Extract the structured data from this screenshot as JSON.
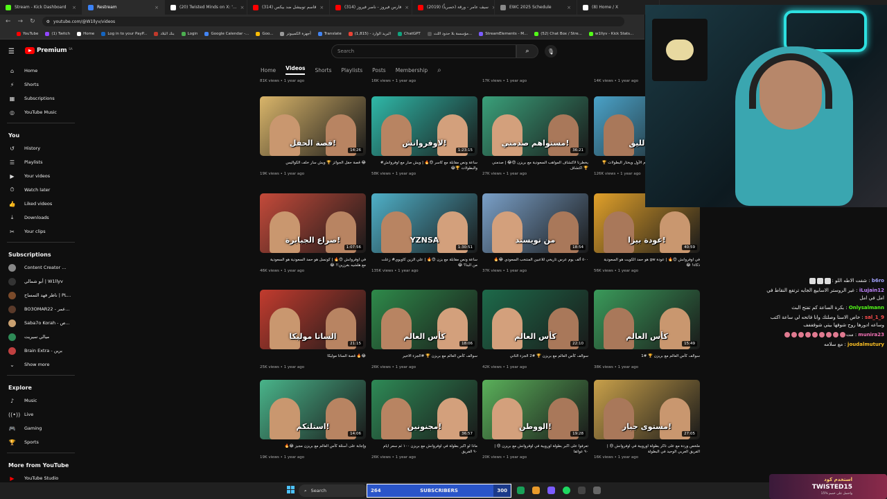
{
  "tabs": [
    {
      "label": "Stream - Kick Dashboard",
      "color": "#53fc18"
    },
    {
      "label": "Restream",
      "color": "#3b82f6"
    },
    {
      "label": "(20) Twisted Minds on X: '...",
      "color": "#ffffff"
    },
    {
      "label": "(314) قاسم توبيشل ضد بيكس",
      "color": "#ff0000"
    },
    {
      "label": "(314) فارس فيروز - ناصر فيروز",
      "color": "#ff0000"
    },
    {
      "label": "(2019) سيف عامر - ورقة (حصرياً)",
      "color": "#ff0000"
    },
    {
      "label": "EWC 2025 Schedule",
      "color": "#888888"
    },
    {
      "label": "(8) Home / X",
      "color": "#ffffff"
    }
  ],
  "address": {
    "url": "youtube.com/@W1llyv/videos"
  },
  "bookmarks": [
    "YouTube",
    "(1) Twitch",
    "Home",
    "Log in to your PayP...",
    "بنك البلاد",
    "Login",
    "Google Calendar -...",
    "Goo...",
    "أجهزة الكمبيوتر",
    "Translate",
    "البريد الوارد - (1,815)",
    "ChatGPT",
    "مؤسسة بلا حدود اللث...",
    "StreamElements - M...",
    "(52) Chat Box / Stre...",
    "w1llyv - Kick Stats..."
  ],
  "youtube": {
    "logo": "Premium",
    "region": "SA",
    "search_placeholder": "Search"
  },
  "sidebar": {
    "main": [
      "Home",
      "Shorts",
      "Subscriptions",
      "YouTube Music"
    ],
    "you_header": "You",
    "you": [
      "History",
      "Playlists",
      "Your videos",
      "Watch later",
      "Liked videos",
      "Downloads",
      "Your clips"
    ],
    "subs_header": "Subscriptions",
    "subs": [
      "Content Creator ...",
      "أبو شمالي | W1llyv",
      "ناظر فهد التمساح | PL...",
      "BO3OMAR22 - عمر...",
      "Saba7o Korah - ص...",
      "ميالي سيريت",
      "Brain Extra - برين"
    ],
    "show_more": "Show more",
    "explore_header": "Explore",
    "explore": [
      "Music",
      "Live",
      "Gaming",
      "Sports"
    ],
    "more_header": "More from YouTube",
    "more": [
      "YouTube Studio"
    ]
  },
  "channel_tabs": [
    "Home",
    "Videos",
    "Shorts",
    "Playlists",
    "Posts",
    "Membership"
  ],
  "top_meta": [
    "81K views • 1 year ago",
    "16K views • 1 year ago",
    "17K views • 1 year ago",
    "14K views • 1 year ago"
  ],
  "videos": [
    {
      "title": "😂 قصة حفل الجوائز 🏆 ويش سار خلف الكواليس",
      "views": "19K views • 1 year ago",
      "duration": "14:26",
      "thumb": "قصة الحفل!",
      "bg": "#d9b56a"
    },
    {
      "title": "ساعة ونص مقابلة مع كاسر 😍🔥 | ويش صار مع اوفروانش# والبطولات 🏆😂",
      "views": "58K views • 1 year ago",
      "duration": "1:23:15",
      "thumb": "لاوفروانش!",
      "bg": "#2fb8a8"
    },
    {
      "title": "يخطرنا لاكتشاف المواهب السعودية مع بريزن 😍😂 | صدمني 🏆 اكتشاف",
      "views": "27K views • 1 year ago",
      "duration": "36:21",
      "thumb": "مستواهم صدمني!",
      "bg": "#3aa07a"
    },
    {
      "title": "اكتشف كل الحقائق 😂🔥 | الموسم الأول ويختار البطولات 🏆😍",
      "views": "126K views • 1 year ago",
      "duration": "",
      "thumb": "من الليق!",
      "bg": "#4aa2c8"
    },
    {
      "title": "في اوفروانش 😍🔥 | كونسل هو حمد السعودية هو السعودية مع هلشيه بغرزين!! 😂",
      "views": "46K views • 1 year ago",
      "duration": "1:07:56",
      "thumb": "صراع الجبابرة!",
      "bg": "#c44a3a"
    },
    {
      "title": "ساعة ونص مقابلة مع يزن 😍🔥 | علي الزين كاوبوي# زعلت من البنا؟ 😂",
      "views": "135K views • 1 year ago",
      "duration": "1:30:51",
      "thumb": "YZNSA",
      "bg": "#4fb0c8"
    },
    {
      "title": "٥٠٠ ألف يوم عرس تاريخي للاعبين المنتخب السعودي 😂🔥",
      "views": "37K views • 1 year ago",
      "duration": "18:54",
      "thumb": "من تويستد",
      "bg": "#7aa0c8"
    },
    {
      "title": "في اوفروانش 😍🔥 | عودة gw هو حمد الكويت هو السعودية ذكاء! 😂",
      "views": "56K views • 1 year ago",
      "duration": "40:59",
      "thumb": "عودة بيزا!",
      "bg": "#e0a02a"
    },
    {
      "title": "😂🔥 قصة الساتا موليكا",
      "views": "25K views • 1 year ago",
      "duration": "21:15",
      "thumb": "الساتا موليكا",
      "bg": "#c23b2e"
    },
    {
      "title": "سوالف كأس العالم مع بريزن 🏆 #الجزء الاخير",
      "views": "26K views • 1 year ago",
      "duration": "18:06",
      "thumb": "كأس العالم",
      "bg": "#2e8a4a"
    },
    {
      "title": "سوالف كأس العالم مع بريزن 🏆 #2 الجزء الثاني",
      "views": "42K views • 1 year ago",
      "duration": "22:10",
      "thumb": "كأس العالم",
      "bg": "#1d6a4a"
    },
    {
      "title": "سوالف كأس العالم مع بريزن 🏆 #1",
      "views": "38K views • 1 year ago",
      "duration": "15:49",
      "thumb": "كأس العالم",
      "bg": "#3a9a5a"
    },
    {
      "title": "وإجابة على أسئلة كأس العالم مع بريزن مجيز 😂🔥",
      "views": "19K views • 1 year ago",
      "duration": "14:06",
      "thumb": "استلتكم!",
      "bg": "#49b48a"
    },
    {
      "title": "ماذا لو اكبر بطولة في اوفروانش مع بريزن ١٠٠ ثم سعر ايام ٩٠ الفريق",
      "views": "26K views • 1 year ago",
      "duration": "36:57",
      "thumb": "مجنونين!",
      "bg": "#2e8a56"
    },
    {
      "title": "تعرفوا على اكبر بطولة اوروبية في اوفروانش مع بريزن 😍 | ٩٠ عوائقا",
      "views": "20K views • 1 year ago",
      "duration": "19:28",
      "thumb": "الووطن!",
      "bg": "#5ab05a"
    },
    {
      "title": "ملخص وردة مع على تاكر بطولة اوروبية في اوفروانش 😍 | الفريق العربي الوحيد في البطولة",
      "views": "16K views • 1 year ago",
      "duration": "27:05",
      "thumb": "مستوى جبار!",
      "bg": "#c8a04a"
    }
  ],
  "chat": [
    {
      "name": "b6ro",
      "text": "شفت الاطه اللو :",
      "emotes": 3,
      "color": "#a5a5ff"
    },
    {
      "name": "iLujain12",
      "text": "غير الروستر الاسابيع الجايه ترتفع النقاط في امل في امل",
      "emotes": 0,
      "color": "#c084fc"
    },
    {
      "name": "Onlysalmann",
      "text": "بكرة الساعة كم تفتح البث",
      "emotes": 0,
      "color": "#53fc18"
    },
    {
      "name": "sal_1_9",
      "text": "خاص الاستا وصلتك وانا فاتحه لي ساعة اكتب وساعه ادورها روح شوفها بيتي شوفففف",
      "emotes": 0,
      "color": "#ff4d4d"
    },
    {
      "name": "munira23",
      "text": "مت",
      "emotes": 9,
      "color": "#f472b6"
    },
    {
      "name": "joudalmutury",
      "text": "مع سلامه",
      "emotes": 0,
      "color": "#fbbf24"
    }
  ],
  "taskbar": {
    "search": "Search",
    "subs_left": "264",
    "subs_label": "SUBSCRIBERS",
    "subs_right": "300",
    "subs_progress": 0.88
  },
  "promo": {
    "line1": "استخدم كود",
    "line2": "TWISTED15",
    "line3": "واحصل على خصم %15"
  }
}
